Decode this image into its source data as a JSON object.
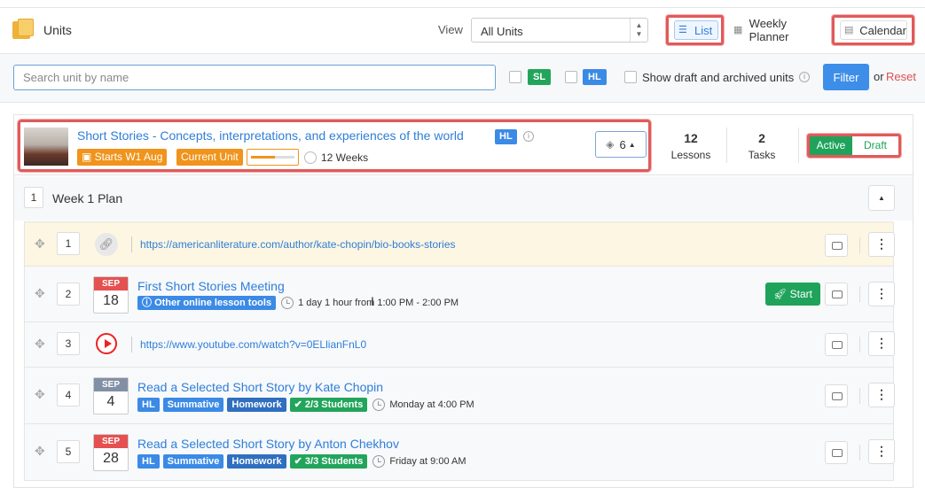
{
  "header": {
    "title": "Units",
    "view_label": "View",
    "view_select_value": "All Units",
    "tabs": {
      "list": "List",
      "weekly": "Weekly Planner",
      "calendar": "Calendar"
    }
  },
  "filters": {
    "search_placeholder": "Search unit by name",
    "sl_label": "SL",
    "hl_label": "HL",
    "show_draft_label": "Show draft and archived units",
    "filter_button": "Filter",
    "or_label": "or",
    "reset_label": "Reset"
  },
  "unit": {
    "title": "Short Stories - Concepts, interpretations, and experiences of the world",
    "level_badge": "HL",
    "start_badge": "Starts W1 Aug",
    "current_badge": "Current Unit",
    "progress_fraction": 0.55,
    "duration": "12 Weeks",
    "layers_count": "6",
    "lessons_count": "12",
    "lessons_label": "Lessons",
    "tasks_count": "2",
    "tasks_label": "Tasks",
    "status_active": "Active",
    "status_draft": "Draft"
  },
  "week": {
    "number": "1",
    "label": "Week 1 Plan"
  },
  "lessons": [
    {
      "num": "1",
      "url": "https://americanliterature.com/author/kate-chopin/bio-books-stories"
    },
    {
      "num": "2",
      "month": "SEP",
      "day": "18",
      "title": "First Short Stories Meeting",
      "tag": "Other online lesson tools",
      "time": "1 day 1 hour from 1:00 PM - 2:00 PM",
      "start_label": "Start"
    },
    {
      "num": "3",
      "url": "https://www.youtube.com/watch?v=0ELlianFnL0"
    },
    {
      "num": "4",
      "month": "SEP",
      "day": "4",
      "title": "Read a Selected Short Story by Kate Chopin",
      "tags": [
        "HL",
        "Summative",
        "Homework"
      ],
      "students": "2/3 Students",
      "time": "Monday at 4:00 PM"
    },
    {
      "num": "5",
      "month": "SEP",
      "day": "28",
      "title": "Read a Selected Short Story by Anton Chekhov",
      "tags": [
        "HL",
        "Summative",
        "Homework"
      ],
      "students": "3/3 Students",
      "time": "Friday at 9:00 AM"
    }
  ],
  "colors": {
    "accent": "#2f7ed8",
    "orange": "#f0941c",
    "green": "#1fa35b",
    "highlight": "#e05a5a"
  }
}
